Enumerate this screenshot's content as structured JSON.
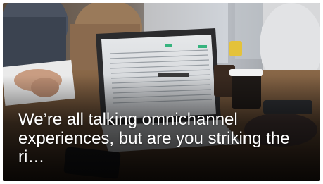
{
  "card": {
    "title": "We’re all talking omnichannel experiences, but are you striking the ri…",
    "image": {
      "subject": "people working at a laptop in an office"
    }
  },
  "colors": {
    "title_text": "#ffffff",
    "overlay": "#000000"
  }
}
